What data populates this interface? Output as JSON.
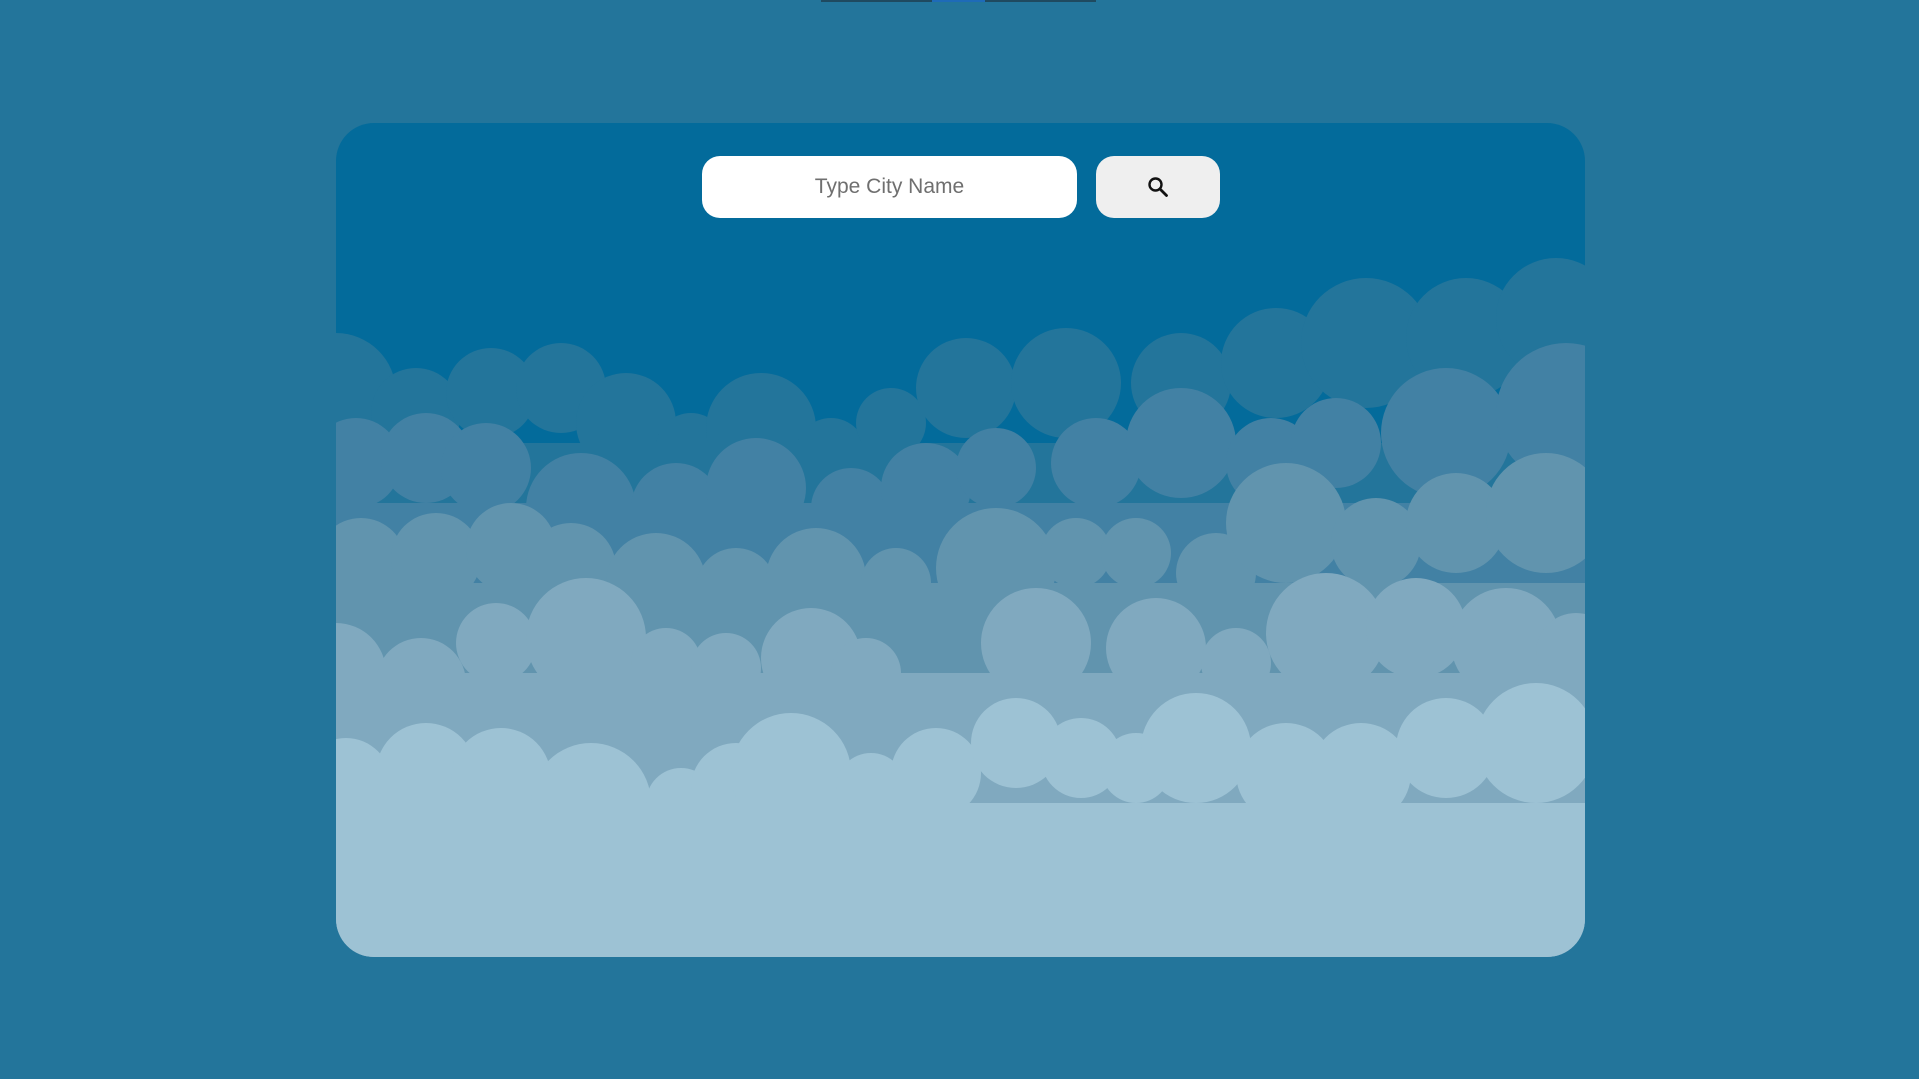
{
  "search": {
    "placeholder": "Type City Name",
    "value": "",
    "button_icon": "search-icon"
  },
  "colors": {
    "page_background": "#23759b",
    "card_sky": "#036b9b",
    "cloud_layer_1": "#23759b",
    "cloud_layer_2": "#4281a4",
    "cloud_layer_3": "#6194ae",
    "cloud_layer_4": "#80a9bf",
    "cloud_layer_5": "#9dc2d4",
    "input_background": "#ffffff",
    "button_background": "#efefef"
  }
}
